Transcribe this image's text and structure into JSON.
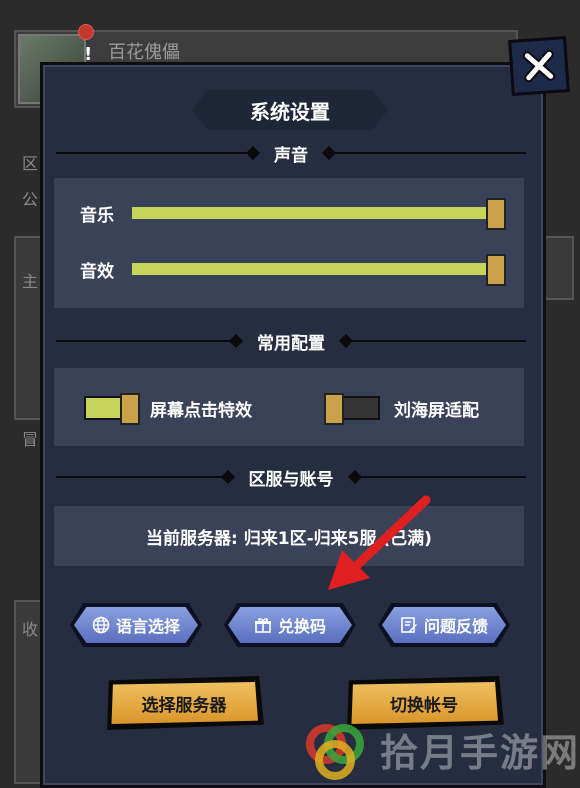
{
  "background": {
    "player_name": "百花傀儡",
    "alert_mark": "!",
    "side_labels": [
      "区",
      "公",
      "主",
      "冒",
      "收"
    ]
  },
  "dialog": {
    "title": "系统设置",
    "sections": {
      "sound": "声音",
      "common": "常用配置",
      "server": "区服与账号"
    },
    "sound": {
      "music_label": "音乐",
      "music_level": 100,
      "sfx_label": "音效",
      "sfx_level": 100
    },
    "common": {
      "tap_effect_label": "屏幕点击特效",
      "tap_effect_on": true,
      "notch_label": "刘海屏适配",
      "notch_on": false
    },
    "server": {
      "current": "当前服务器: 归来1区-归来5服 (已满)"
    },
    "buttons": {
      "language": "语言选择",
      "redeem": "兑换码",
      "feedback": "问题反馈",
      "select_server": "选择服务器",
      "switch_account": "切换帐号"
    }
  },
  "watermark": {
    "text": "拾月手游网"
  },
  "colors": {
    "accent_green": "#c6d45a",
    "knob_gold": "#c9a24a",
    "panel": "#262d40",
    "button_blue": "#6f86d6",
    "button_gold": "#e8aa40",
    "arrow_red": "#e02020"
  }
}
